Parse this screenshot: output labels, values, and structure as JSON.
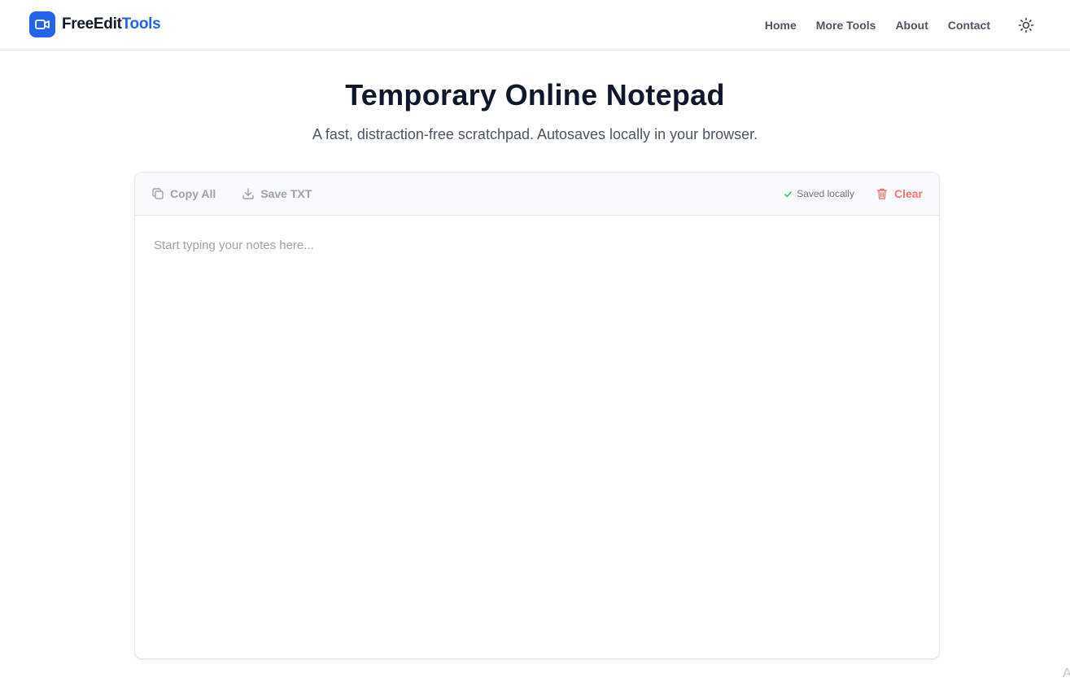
{
  "brand": {
    "name_part1": "FreeEdit",
    "name_part2": "Tools",
    "logo_icon": "video-camera-icon",
    "accent_color": "#2563eb"
  },
  "nav": {
    "links": [
      {
        "label": "Home"
      },
      {
        "label": "More Tools"
      },
      {
        "label": "About"
      },
      {
        "label": "Contact"
      }
    ],
    "theme_toggle_icon": "sun-icon"
  },
  "hero": {
    "title": "Temporary Online Notepad",
    "subtitle": "A fast, distraction-free scratchpad. Autosaves locally in your browser."
  },
  "toolbar": {
    "copy_label": "Copy All",
    "copy_icon": "copy-icon",
    "save_label": "Save TXT",
    "save_icon": "download-icon",
    "status_text": "Saved locally",
    "status_icon": "check-icon",
    "status_color": "#22c55e",
    "clear_label": "Clear",
    "clear_icon": "trash-icon",
    "clear_color": "#f87171"
  },
  "editor": {
    "placeholder": "Start typing your notes here...",
    "value": ""
  },
  "corner": {
    "text": "A"
  }
}
